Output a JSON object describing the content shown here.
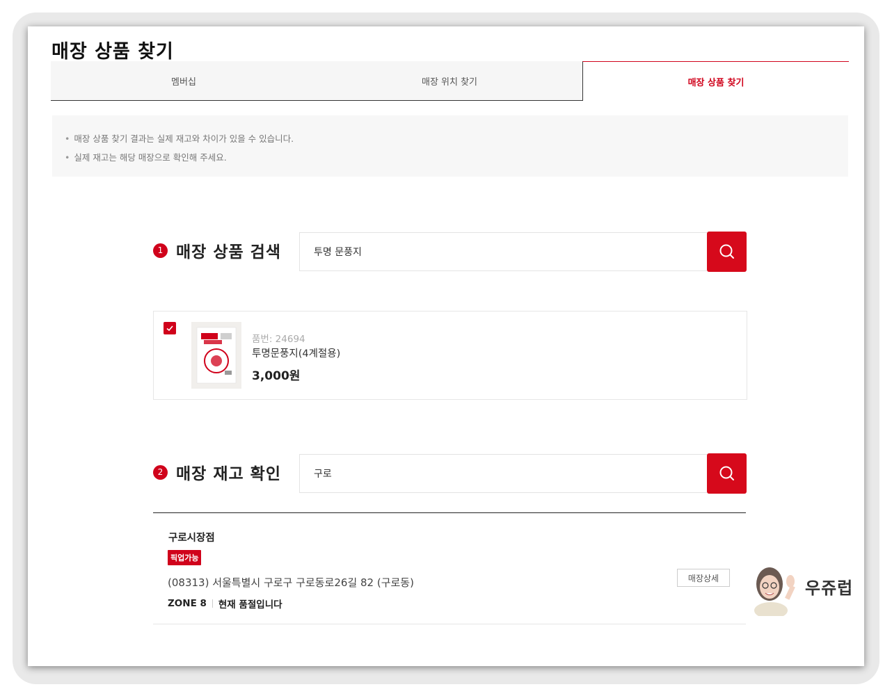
{
  "page": {
    "title": "매장 상품 찾기"
  },
  "tabs": [
    {
      "label": "멤버십",
      "active": false
    },
    {
      "label": "매장 위치 찾기",
      "active": false
    },
    {
      "label": "매장 상품 찾기",
      "active": true
    }
  ],
  "notice": {
    "items": [
      "매장 상품 찾기 결과는 실제 재고와 차이가 있을 수 있습니다.",
      "실제 재고는 해당 매장으로 확인해 주세요."
    ]
  },
  "product_search": {
    "step": "1",
    "title": "매장 상품 검색",
    "query": "투명 문풍지",
    "button_icon": "search-icon"
  },
  "product": {
    "checked": true,
    "code_label": "품번: 24694",
    "name": "투명문풍지(4계절용)",
    "price": "3,000원"
  },
  "stock_search": {
    "step": "2",
    "title": "매장 재고 확인",
    "query": "구로",
    "button_icon": "search-icon"
  },
  "store": {
    "name": "구로시장점",
    "badge": "픽업가능",
    "address": "(08313) 서울특별시 구로구 구로동로26길 82 (구로동)",
    "zone": "ZONE 8",
    "stock_status": "현재 품절입니다",
    "detail_button": "매장상세"
  },
  "watermark": {
    "text": "우쥬럽"
  },
  "colors": {
    "accent": "#d0021b",
    "search_button": "#d6091b",
    "notice_bg": "#f7f7f7"
  }
}
